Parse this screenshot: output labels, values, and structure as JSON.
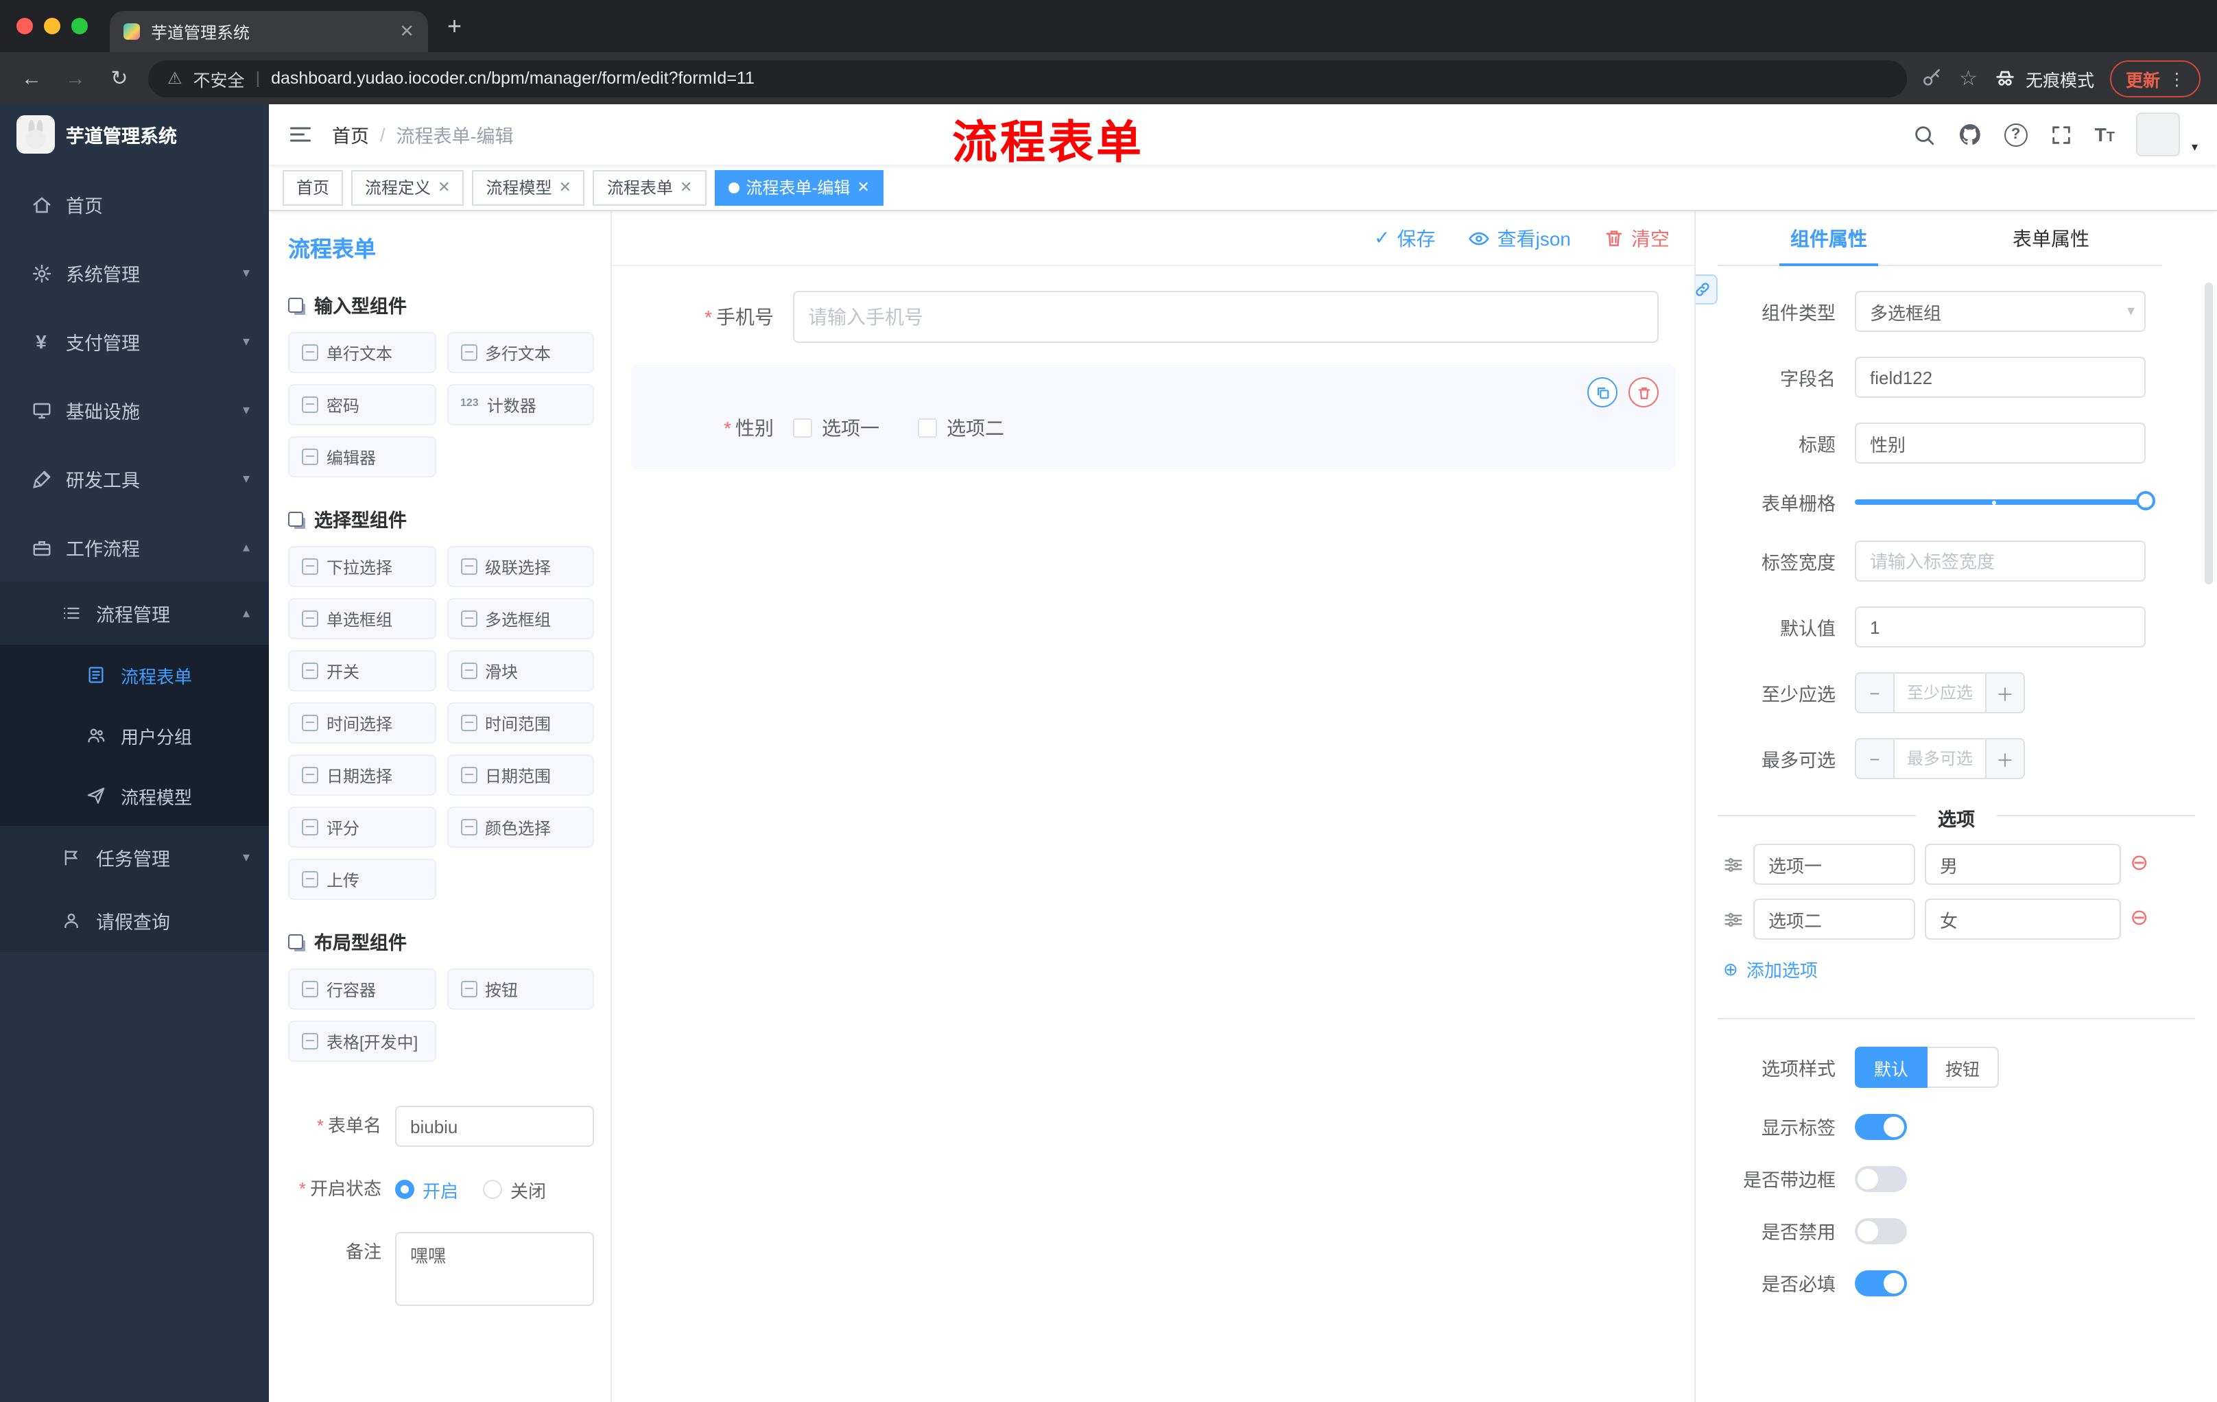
{
  "browser": {
    "tab_title": "芋道管理系统",
    "security_label": "不安全",
    "url": "dashboard.yudao.iocoder.cn/bpm/manager/form/edit?formId=11",
    "incognito_label": "无痕模式",
    "update_label": "更新"
  },
  "sidebar": {
    "logo_title": "芋道管理系统",
    "items": {
      "home": "首页",
      "system": "系统管理",
      "payment": "支付管理",
      "infra": "基础设施",
      "dev_tools": "研发工具",
      "workflow": "工作流程",
      "process_mgmt": "流程管理",
      "process_form": "流程表单",
      "user_group": "用户分组",
      "process_model": "流程模型",
      "task_mgmt": "任务管理",
      "leave_query": "请假查询"
    }
  },
  "header": {
    "breadcrumb_home": "首页",
    "breadcrumb_current": "流程表单-编辑",
    "annotation": "流程表单"
  },
  "tags": [
    "首页",
    "流程定义",
    "流程模型",
    "流程表单",
    "流程表单-编辑"
  ],
  "palette": {
    "title": "流程表单",
    "sections": [
      {
        "title": "输入型组件",
        "items": [
          "单行文本",
          "多行文本",
          "密码",
          "计数器",
          "编辑器"
        ]
      },
      {
        "title": "选择型组件",
        "items": [
          "下拉选择",
          "级联选择",
          "单选框组",
          "多选框组",
          "开关",
          "滑块",
          "时间选择",
          "时间范围",
          "日期选择",
          "日期范围",
          "评分",
          "颜色选择",
          "上传"
        ]
      },
      {
        "title": "布局型组件",
        "items": [
          "行容器",
          "按钮",
          "表格[开发中]"
        ]
      }
    ],
    "form": {
      "name_label": "表单名",
      "name_value": "biubiu",
      "status_label": "开启状态",
      "status_on": "开启",
      "status_off": "关闭",
      "remark_label": "备注",
      "remark_value": "嘿嘿"
    }
  },
  "canvas": {
    "save": "保存",
    "view_json": "查看json",
    "clear": "清空",
    "phone_label": "手机号",
    "phone_placeholder": "请输入手机号",
    "gender_label": "性别",
    "gender_options": [
      "选项一",
      "选项二"
    ]
  },
  "inspector": {
    "tab_component": "组件属性",
    "tab_form": "表单属性",
    "component_type_label": "组件类型",
    "component_type_value": "多选框组",
    "field_name_label": "字段名",
    "field_name_value": "field122",
    "title_label": "标题",
    "title_value": "性别",
    "grid_label": "表单栅格",
    "label_width_label": "标签宽度",
    "label_width_placeholder": "请输入标签宽度",
    "default_label": "默认值",
    "default_value": "1",
    "min_label": "至少应选",
    "min_placeholder": "至少应选",
    "max_label": "最多可选",
    "max_placeholder": "最多可选",
    "options_title": "选项",
    "options": [
      {
        "label": "选项一",
        "value": "男"
      },
      {
        "label": "选项二",
        "value": "女"
      }
    ],
    "add_option": "添加选项",
    "style_label": "选项样式",
    "style_default": "默认",
    "style_button": "按钮",
    "toggle_show_label": "显示标签",
    "toggle_border": "是否带边框",
    "toggle_disabled": "是否禁用",
    "toggle_required": "是否必填"
  },
  "colors": {
    "primary": "#409EFF",
    "danger": "#F56C6C",
    "annotation": "#FF0000"
  }
}
